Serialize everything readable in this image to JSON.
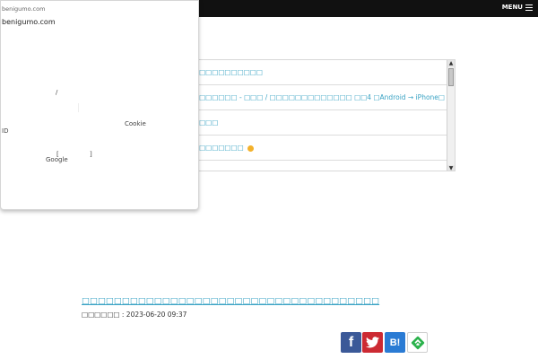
{
  "header": {
    "menu_label": "MENU"
  },
  "list": {
    "items": [
      {
        "text": "□□□□□□□□□□□",
        "coin": false
      },
      {
        "text": "□□□□□□□ - □□□ / □□□□□□□□□□□□□ □□4 □Android → iPhone□",
        "coin": false
      },
      {
        "text": "□□□□",
        "coin": false
      },
      {
        "text": "□□□□□□□□",
        "coin": true
      }
    ]
  },
  "popup": {
    "domain_small": "benigumo.com",
    "domain": "benigumo.com",
    "slash": "/",
    "cookie": "Cookie",
    "id": "ID",
    "bracket_open": "[",
    "bracket_close": "]",
    "google": "Google"
  },
  "article": {
    "title": "□□□□□□□□□□□□□□□□□□□□□□□□□□□□□□□□□□□□□",
    "date": "□□□□□□ : 2023-06-20 09:37"
  },
  "share": {
    "facebook_icon": "f",
    "hatena_icon": "B!"
  },
  "colors": {
    "link": "#3aa3c4",
    "topbar": "#111111",
    "facebook": "#3b5998",
    "twitter": "#cc2a33",
    "hatena": "#2a7bd4",
    "feedly": "#2bb24c"
  }
}
